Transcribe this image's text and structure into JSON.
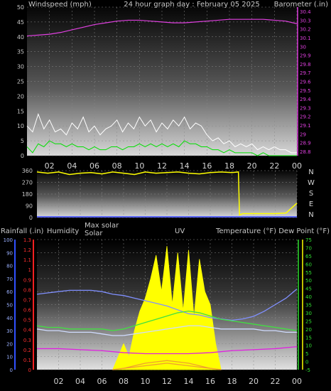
{
  "chart_data": [
    {
      "type": "line",
      "panel": "wind_baro",
      "header_left": "Windspeed (mph)",
      "title": "24 hour graph day : February 05 2025",
      "header_right": "Barometer (.in)",
      "x_ticks": [
        "02",
        "04",
        "06",
        "08",
        "10",
        "12",
        "14",
        "16",
        "18",
        "20",
        "22",
        "00"
      ],
      "y_left_ticks": [
        "0",
        "5",
        "10",
        "15",
        "20",
        "25",
        "30",
        "35",
        "40",
        "45",
        "50"
      ],
      "y_left_range": [
        0,
        50
      ],
      "y_right_ticks": [
        "28.8",
        "28.9",
        "29",
        "29.1",
        "29.2",
        "29.3",
        "29.4",
        "29.5",
        "29.6",
        "29.7",
        "29.8",
        "29.9",
        "30",
        "30.1",
        "30.2",
        "30.3",
        "30.4"
      ],
      "y_right_range": [
        28.75,
        30.45
      ],
      "series": [
        {
          "axis": "right",
          "color": "#e040e0",
          "x": [
            0,
            1,
            2,
            3,
            4,
            5,
            6,
            7,
            8,
            9,
            10,
            11,
            12,
            13,
            14,
            15,
            16,
            17,
            18,
            19,
            20,
            21,
            22,
            23,
            24
          ],
          "values": [
            30.12,
            30.13,
            30.14,
            30.16,
            30.19,
            30.22,
            30.25,
            30.27,
            30.29,
            30.3,
            30.3,
            30.29,
            30.28,
            30.27,
            30.27,
            30.28,
            30.29,
            30.3,
            30.31,
            30.31,
            30.31,
            30.31,
            30.3,
            30.29,
            30.26
          ]
        },
        {
          "axis": "left",
          "color": "#ffffff",
          "x": [
            0,
            0.5,
            1,
            1.5,
            2,
            2.5,
            3,
            3.5,
            4,
            4.5,
            5,
            5.5,
            6,
            6.5,
            7,
            7.5,
            8,
            8.5,
            9,
            9.5,
            10,
            10.5,
            11,
            11.5,
            12,
            12.5,
            13,
            13.5,
            14,
            14.5,
            15,
            15.5,
            16,
            16.5,
            17,
            17.5,
            18,
            18.5,
            19,
            19.5,
            20,
            20.5,
            21,
            21.5,
            22,
            22.5,
            23,
            23.5,
            24
          ],
          "values": [
            10,
            8,
            14,
            9,
            12,
            8,
            9,
            7,
            11,
            9,
            13,
            8,
            10,
            7,
            9,
            10,
            12,
            8,
            11,
            9,
            13,
            10,
            12,
            8,
            11,
            9,
            12,
            10,
            13,
            9,
            11,
            10,
            7,
            5,
            6,
            4,
            5,
            3,
            4,
            3,
            4,
            2,
            3,
            2,
            3,
            2,
            2,
            1,
            1
          ]
        },
        {
          "axis": "left",
          "color": "#00e000",
          "x": [
            0,
            0.5,
            1,
            1.5,
            2,
            2.5,
            3,
            3.5,
            4,
            4.5,
            5,
            5.5,
            6,
            6.5,
            7,
            7.5,
            8,
            8.5,
            9,
            9.5,
            10,
            10.5,
            11,
            11.5,
            12,
            12.5,
            13,
            13.5,
            14,
            14.5,
            15,
            15.5,
            16,
            16.5,
            17,
            17.5,
            18,
            18.5,
            19,
            19.5,
            20,
            20.5,
            21,
            21.5,
            22,
            22.5,
            23,
            23.5,
            24
          ],
          "values": [
            3,
            1,
            4,
            3,
            5,
            4,
            4,
            3,
            4,
            3,
            3,
            2,
            3,
            2,
            2,
            3,
            3,
            2,
            3,
            3,
            4,
            3,
            4,
            3,
            4,
            3,
            4,
            3,
            5,
            4,
            4,
            3,
            3,
            2,
            2,
            1,
            2,
            1,
            1,
            1,
            1,
            0,
            1,
            0,
            0,
            0,
            0,
            0,
            0
          ]
        }
      ]
    },
    {
      "type": "line",
      "panel": "wind_direction",
      "y_ticks": [
        "0",
        "90",
        "180",
        "270",
        "360"
      ],
      "y_range": [
        0,
        360
      ],
      "direction_labels": [
        "N",
        "W",
        "S",
        "E",
        "N"
      ],
      "series": [
        {
          "color": "#ffff00",
          "x": [
            0,
            1,
            2,
            3,
            4,
            5,
            6,
            7,
            8,
            9,
            10,
            11,
            12,
            13,
            14,
            15,
            16,
            17,
            18,
            18.6,
            18.7,
            19,
            20,
            21,
            22,
            23,
            24
          ],
          "values": [
            350,
            340,
            350,
            330,
            340,
            345,
            335,
            350,
            340,
            330,
            350,
            340,
            345,
            350,
            340,
            335,
            345,
            350,
            345,
            350,
            20,
            30,
            30,
            30,
            30,
            35,
            110
          ]
        }
      ]
    },
    {
      "type": "area",
      "panel": "rain_humidity_solar_uv_temp",
      "header_labels": [
        "Rainfall (.in)",
        "Humidity",
        "Max solar",
        "Solar",
        "UV",
        "Temperature (°F) Dew Point (°F)"
      ],
      "x_ticks": [
        "02",
        "04",
        "06",
        "08",
        "10",
        "12",
        "14",
        "16",
        "18",
        "20",
        "22",
        "00"
      ],
      "humidity_ticks": [
        "0",
        "10",
        "20",
        "30",
        "40",
        "50",
        "60",
        "70",
        "80",
        "90",
        "100"
      ],
      "rain_ticks": [
        "0",
        "0.1",
        "0.2",
        "0.3",
        "0.4",
        "0.5",
        "0.6",
        "0.7",
        "0.8",
        "0.9",
        "1",
        "1.1",
        "1.2",
        "1.3"
      ],
      "temp_ticks": [
        "-5",
        "0",
        "5",
        "10",
        "15",
        "20",
        "25",
        "30",
        "35",
        "40",
        "45",
        "50",
        "55",
        "60",
        "65",
        "70",
        "75"
      ],
      "temp_range": [
        -5,
        75
      ],
      "series": [
        {
          "name": "Humidity",
          "axis": "humidity",
          "color": "#8090ff",
          "x": [
            0,
            1,
            2,
            3,
            4,
            5,
            6,
            7,
            8,
            9,
            10,
            11,
            12,
            13,
            14,
            15,
            16,
            17,
            18,
            19,
            20,
            21,
            22,
            23,
            24
          ],
          "values": [
            58,
            59,
            60,
            61,
            61,
            61,
            60,
            58,
            57,
            55,
            53,
            51,
            49,
            46,
            43,
            42,
            40,
            39,
            38,
            39,
            41,
            45,
            50,
            55,
            62
          ]
        },
        {
          "name": "Temperature",
          "axis": "temp",
          "color": "#40e040",
          "x": [
            0,
            1,
            2,
            3,
            4,
            5,
            6,
            7,
            8,
            9,
            10,
            11,
            12,
            13,
            14,
            15,
            16,
            17,
            18,
            19,
            20,
            21,
            22,
            23,
            24
          ],
          "values": [
            22,
            21,
            21,
            20,
            20,
            20,
            20,
            19,
            20,
            22,
            24,
            26,
            28,
            30,
            31,
            30,
            28,
            26,
            25,
            24,
            23,
            22,
            21,
            20,
            19
          ]
        },
        {
          "name": "Dew Point",
          "axis": "temp",
          "color": "#d0dcff",
          "x": [
            0,
            1,
            2,
            3,
            4,
            5,
            6,
            7,
            8,
            9,
            10,
            11,
            12,
            13,
            14,
            15,
            16,
            17,
            18,
            19,
            20,
            21,
            22,
            23,
            24
          ],
          "values": [
            20,
            19,
            19,
            18,
            18,
            18,
            17,
            16,
            16,
            17,
            18,
            19,
            20,
            21,
            22,
            22,
            21,
            20,
            20,
            20,
            20,
            19,
            19,
            18,
            18
          ]
        },
        {
          "name": "Rainfall",
          "axis": "rain",
          "color": "#e020e0",
          "x": [
            0,
            2,
            4,
            6,
            8,
            10,
            12,
            14,
            16,
            18,
            20,
            22,
            24
          ],
          "values": [
            0.21,
            0.21,
            0.2,
            0.19,
            0.17,
            0.16,
            0.16,
            0.16,
            0.17,
            0.19,
            0.2,
            0.21,
            0.23
          ]
        },
        {
          "name": "Max solar",
          "axis": "humidity",
          "color": "#f0a030",
          "x": [
            7,
            8,
            9,
            10,
            11,
            12,
            13,
            14,
            15,
            16,
            17
          ],
          "values": [
            0,
            1,
            3,
            5,
            6,
            7,
            6,
            5,
            3,
            1,
            0
          ]
        },
        {
          "name": "UV",
          "axis": "humidity",
          "color": "#f0a030",
          "x": [
            7,
            8,
            9,
            10,
            11,
            12,
            13,
            14,
            15,
            16,
            17
          ],
          "values": [
            0,
            1,
            2,
            3,
            4,
            5,
            4,
            3,
            2,
            1,
            0
          ]
        },
        {
          "name": "Solar",
          "axis": "humidity",
          "color": "#ffff00",
          "x": [
            7,
            8,
            8.5,
            9,
            9.5,
            10,
            10.5,
            11,
            11.5,
            12,
            12.5,
            13,
            13.5,
            14,
            14.5,
            15,
            15.5,
            16,
            16.5,
            17
          ],
          "values": [
            0,
            20,
            10,
            30,
            45,
            55,
            70,
            88,
            60,
            95,
            50,
            90,
            45,
            92,
            40,
            85,
            60,
            50,
            20,
            0
          ]
        }
      ]
    }
  ]
}
